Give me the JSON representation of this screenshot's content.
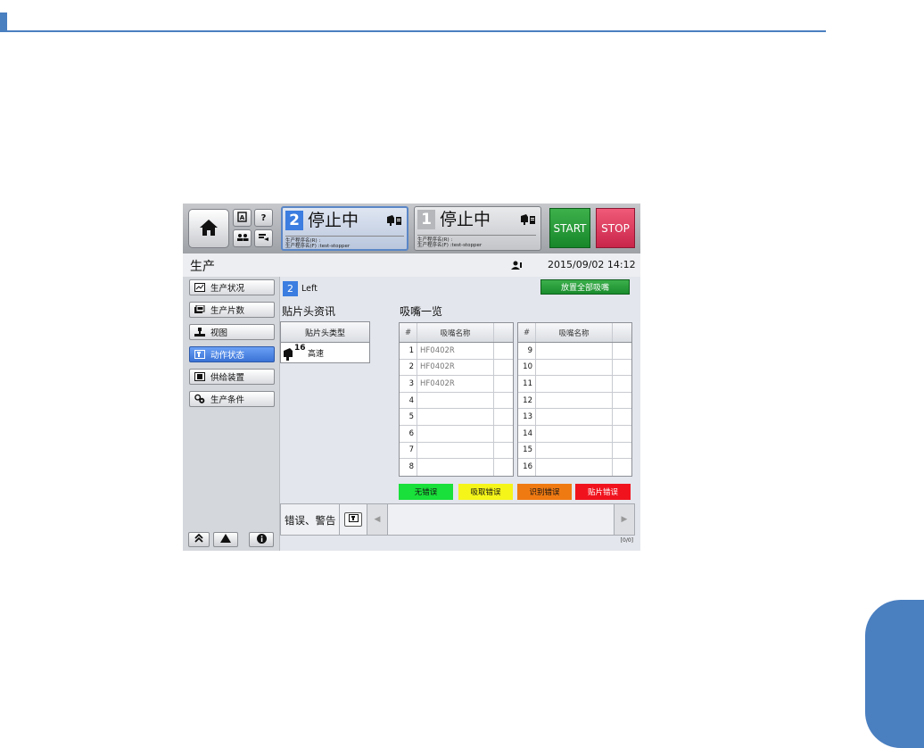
{
  "top_bar": {
    "lanes": [
      {
        "number": "2",
        "status": "停止中",
        "program_r": "生产程序名(R) :",
        "program_f": "生产程序名(F) :test-stopper",
        "active": true
      },
      {
        "number": "1",
        "status": "停止中",
        "program_r": "生产程序名(R) :",
        "program_f": "生产程序名(F) :test-stopper",
        "active": false
      }
    ],
    "start_label": "START",
    "stop_label": "STOP",
    "help_label": "?",
    "colors": {
      "start": "#1f9a33",
      "stop": "#e03a5d",
      "active_lane": "#3b7de0"
    }
  },
  "title_bar": {
    "title": "生产",
    "datetime": "2015/09/02 14:12"
  },
  "sidebar": {
    "items": [
      {
        "label": "生产状况",
        "icon": "status-icon",
        "active": false
      },
      {
        "label": "生产片数",
        "icon": "count-icon",
        "active": false
      },
      {
        "label": "视图",
        "icon": "view-icon",
        "active": false
      },
      {
        "label": "动作状态",
        "icon": "action-icon",
        "active": true
      },
      {
        "label": "供给装置",
        "icon": "feeder-icon",
        "active": false
      },
      {
        "label": "生产条件",
        "icon": "settings-icon",
        "active": false
      }
    ]
  },
  "main": {
    "lane_number": "2",
    "lane_label": "Left",
    "place_all_button": "放置全部吸嘴",
    "head_info": {
      "title": "贴片头资讯",
      "column": "贴片头类型",
      "head_count": "16",
      "head_type": "高速"
    },
    "nozzle_list": {
      "title": "吸嘴一览",
      "col_num": "#",
      "col_name": "吸嘴名称",
      "left_rows": [
        {
          "num": "1",
          "name": "HF0402R"
        },
        {
          "num": "2",
          "name": "HF0402R"
        },
        {
          "num": "3",
          "name": "HF0402R"
        },
        {
          "num": "4",
          "name": ""
        },
        {
          "num": "5",
          "name": ""
        },
        {
          "num": "6",
          "name": ""
        },
        {
          "num": "7",
          "name": ""
        },
        {
          "num": "8",
          "name": ""
        }
      ],
      "right_rows": [
        {
          "num": "9",
          "name": ""
        },
        {
          "num": "10",
          "name": ""
        },
        {
          "num": "11",
          "name": ""
        },
        {
          "num": "12",
          "name": ""
        },
        {
          "num": "13",
          "name": ""
        },
        {
          "num": "14",
          "name": ""
        },
        {
          "num": "15",
          "name": ""
        },
        {
          "num": "16",
          "name": ""
        }
      ]
    },
    "legend": [
      {
        "label": "无错误",
        "color": "#19e03a",
        "text_color": "#111111"
      },
      {
        "label": "吸取错误",
        "color": "#f5f51a",
        "text_color": "#111111"
      },
      {
        "label": "识别错误",
        "color": "#f07a12",
        "text_color": "#111111"
      },
      {
        "label": "贴片错误",
        "color": "#f0131e",
        "text_color": "#ffffff"
      }
    ],
    "error_panel": {
      "title": "错误、警告",
      "count": "[0/0]"
    }
  }
}
